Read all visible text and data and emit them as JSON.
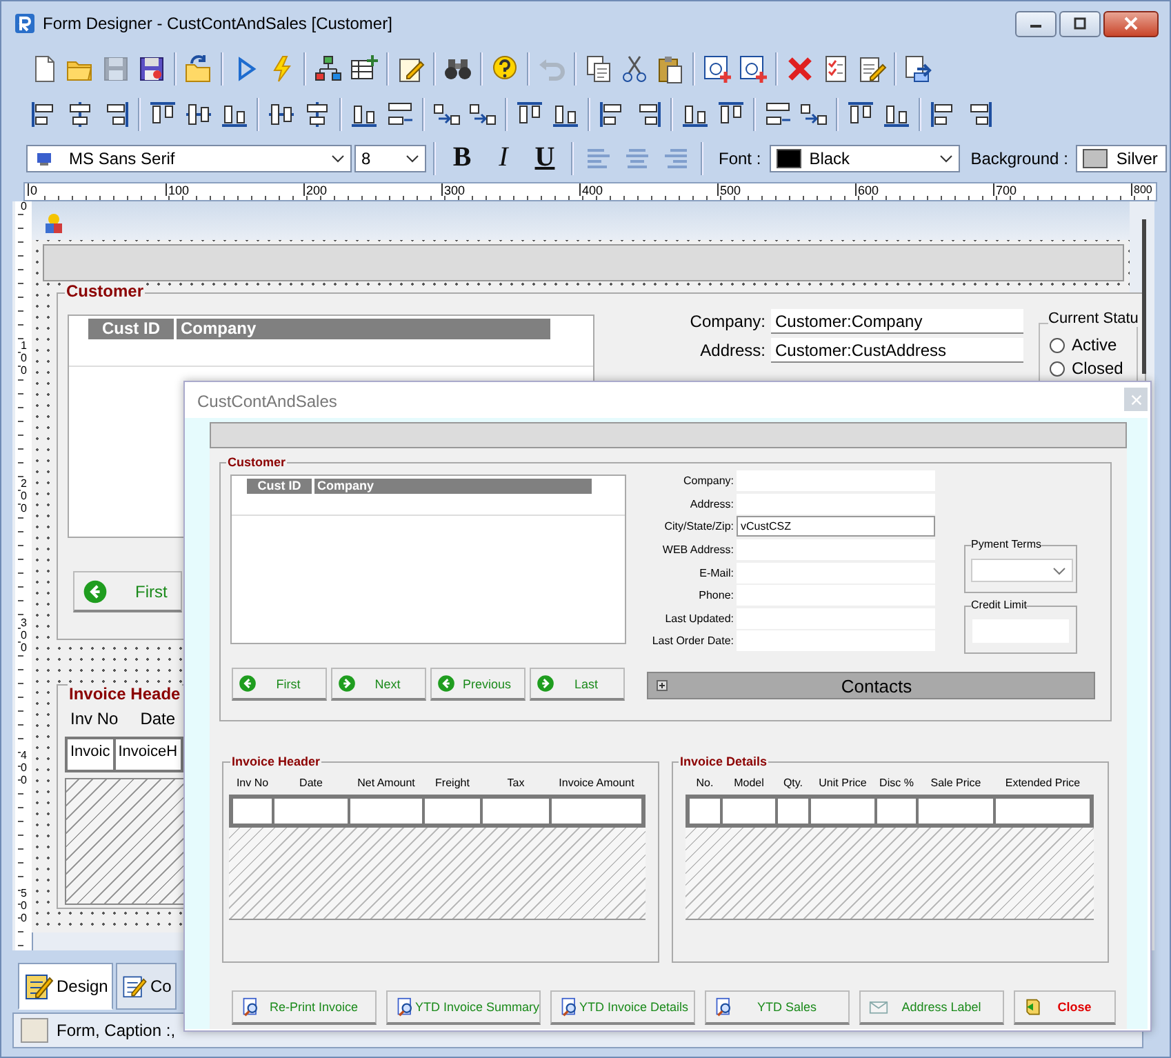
{
  "window": {
    "title": "Form Designer - CustContAndSales [Customer]"
  },
  "toolbars": [
    {
      "buttons": [
        {
          "disabled": false
        },
        {
          "disabled": false
        },
        {
          "disabled": true
        },
        {
          "disabled": false
        },
        {
          "disabled": false
        },
        {
          "disabled": false
        },
        {
          "disabled": false
        },
        {
          "disabled": false
        },
        {
          "disabled": false
        },
        {
          "disabled": false
        },
        {
          "disabled": false
        },
        {
          "disabled": false
        },
        {
          "disabled": true
        },
        {
          "disabled": false
        },
        {
          "disabled": false
        },
        {
          "disabled": false
        },
        {
          "disabled": false
        },
        {
          "disabled": false
        },
        {
          "disabled": false
        },
        {
          "disabled": false
        },
        {
          "disabled": false
        },
        {
          "disabled": false
        }
      ]
    },
    {
      "buttons": [
        {
          "disabled": false
        },
        {
          "disabled": false
        },
        {
          "disabled": false
        },
        {
          "disabled": false
        },
        {
          "disabled": false
        },
        {
          "disabled": false
        },
        {
          "disabled": false
        },
        {
          "disabled": false
        },
        {
          "disabled": false
        },
        {
          "disabled": false
        },
        {
          "disabled": false
        },
        {
          "disabled": false
        },
        {
          "disabled": false
        },
        {
          "disabled": false
        },
        {
          "disabled": false
        },
        {
          "disabled": false
        },
        {
          "disabled": false
        },
        {
          "disabled": false
        },
        {
          "disabled": false
        },
        {
          "disabled": false
        },
        {
          "disabled": false
        },
        {
          "disabled": false
        },
        {
          "disabled": false
        },
        {
          "disabled": false
        }
      ]
    }
  ],
  "format_bar": {
    "font_name": "MS Sans Serif",
    "font_size": "8",
    "bold": "B",
    "italic": "I",
    "underline": "U",
    "align_buttons": [
      {
        "disabled": true
      },
      {
        "disabled": true
      },
      {
        "disabled": true
      }
    ],
    "font_label": "Font :",
    "font_color": "Black",
    "background_label": "Background :",
    "background_color": "Silver"
  },
  "ruler": {
    "marks": [
      "0",
      "100",
      "200",
      "300",
      "400",
      "500",
      "600",
      "700",
      "800"
    ]
  },
  "vertical_ruler": {
    "marks": [
      "0",
      "100",
      "200",
      "300",
      "400",
      "500"
    ]
  },
  "design_form": {
    "customer_group": {
      "title": "Customer",
      "grid_columns": [
        "Cust ID",
        "Company"
      ],
      "fields": [
        {
          "label": "Company:",
          "value": "Customer:Company"
        },
        {
          "label": "Address:",
          "value": "Customer:CustAddress"
        }
      ],
      "status_group": {
        "title": "Current Statu",
        "options": [
          {
            "label": "Active",
            "selected": false
          },
          {
            "label": "Closed",
            "selected": false
          }
        ]
      },
      "nav_button": "First"
    },
    "invoice_group": {
      "title": "Invoice Heade",
      "columns": [
        "Inv No",
        "Date"
      ],
      "cells": [
        "Invoic",
        "InvoiceH"
      ]
    }
  },
  "preview": {
    "title": "CustContAndSales",
    "customer": {
      "title": "Customer",
      "grid_columns": [
        "Cust ID",
        "Company"
      ],
      "fields": [
        {
          "label": "Company:"
        },
        {
          "label": "Address:"
        },
        {
          "label": "City/State/Zip:",
          "value": "vCustCSZ"
        },
        {
          "label": "WEB Address:"
        },
        {
          "label": "E-Mail:"
        },
        {
          "label": "Phone:"
        },
        {
          "label": "Last Updated:"
        },
        {
          "label": "Last Order Date:"
        }
      ],
      "payment_terms": {
        "title": "Pyment Terms"
      },
      "credit_limit": {
        "title": "Credit Limit"
      },
      "nav_buttons": [
        {
          "label": "First",
          "kind": "prev"
        },
        {
          "label": "Next",
          "kind": "next"
        },
        {
          "label": "Previous",
          "kind": "prev"
        },
        {
          "label": "Last",
          "kind": "next"
        }
      ],
      "contacts": {
        "label": "Contacts"
      }
    },
    "invoice_header": {
      "title": "Invoice Header",
      "columns": [
        "Inv No",
        "Date",
        "Net Amount",
        "Freight",
        "Tax",
        "Invoice Amount"
      ]
    },
    "invoice_details": {
      "title": "Invoice Details",
      "columns": [
        "No.",
        "Model",
        "Qty.",
        "Unit Price",
        "Disc %",
        "Sale Price",
        "Extended Price"
      ]
    },
    "buttons": [
      {
        "label": "Re-Print Invoice",
        "kind": "report"
      },
      {
        "label": "YTD Invoice Summary",
        "kind": "report"
      },
      {
        "label": "YTD Invoice Details",
        "kind": "report"
      },
      {
        "label": "YTD Sales",
        "kind": "report"
      },
      {
        "label": "Address Label",
        "kind": "label"
      },
      {
        "label": "Close",
        "kind": "close"
      }
    ]
  },
  "tabs": [
    {
      "label": "Design",
      "selected": true
    },
    {
      "label": "Co",
      "selected": false
    }
  ],
  "status_bar": {
    "text": "Form, Caption :,"
  }
}
